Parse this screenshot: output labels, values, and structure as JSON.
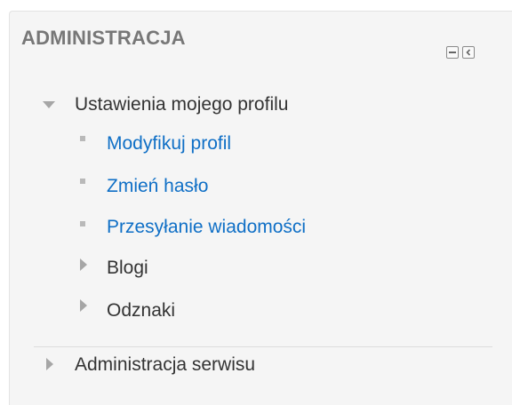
{
  "block": {
    "title": "ADMINISTRACJA",
    "controls": [
      {
        "icon": "minimize-icon"
      },
      {
        "icon": "dock-icon"
      }
    ]
  },
  "tree": {
    "profile_settings": {
      "label": "Ustawienia mojego profilu",
      "expanded": true,
      "children": [
        {
          "label": "Modyfikuj profil",
          "type": "link"
        },
        {
          "label": "Zmień hasło",
          "type": "link"
        },
        {
          "label": "Przesyłanie wiadomości",
          "type": "link"
        },
        {
          "label": "Blogi",
          "type": "collapsed-branch"
        },
        {
          "label": "Odznaki",
          "type": "collapsed-branch"
        }
      ]
    },
    "site_admin": {
      "label": "Administracja serwisu",
      "expanded": false
    }
  },
  "colors": {
    "link": "#0f6fc6",
    "text": "#333333",
    "title": "#777777",
    "panel_bg": "#f5f5f5"
  }
}
